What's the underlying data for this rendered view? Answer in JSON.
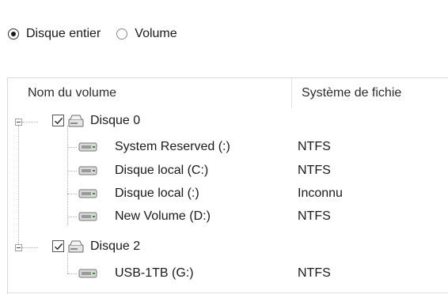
{
  "partition_mode": {
    "options": [
      {
        "label": "Disque entier",
        "selected": true
      },
      {
        "label": "Volume",
        "selected": false
      }
    ]
  },
  "columns": {
    "name": "Nom du volume",
    "filesystem": "Système de fichie"
  },
  "disks": [
    {
      "label": "Disque 0",
      "checked": true,
      "volumes": [
        {
          "name": "System Reserved (:)",
          "filesystem": "NTFS"
        },
        {
          "name": "Disque local (C:)",
          "filesystem": "NTFS"
        },
        {
          "name": "Disque local (:)",
          "filesystem": "Inconnu"
        },
        {
          "name": "New Volume (D:)",
          "filesystem": "NTFS"
        }
      ]
    },
    {
      "label": "Disque 2",
      "checked": true,
      "volumes": [
        {
          "name": "USB-1TB (G:)",
          "filesystem": "NTFS"
        }
      ]
    }
  ],
  "icons": {
    "radio": "radio-button",
    "disk": "hard-disk-icon",
    "volume": "volume-drive-icon",
    "checkmark": "checkmark-icon"
  }
}
